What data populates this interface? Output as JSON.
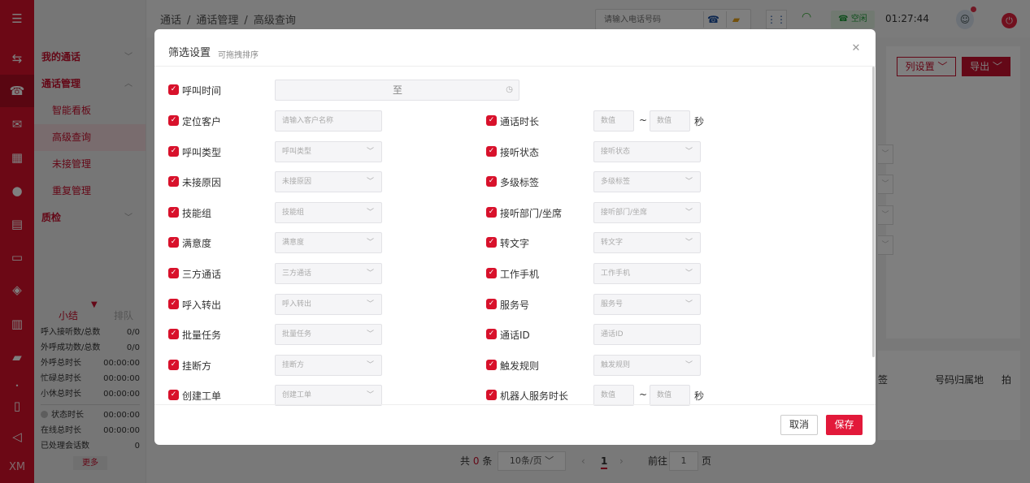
{
  "colors": {
    "brand": "#d8112b",
    "accent_dark": "#b30d22",
    "ok_green": "#1f9c3a",
    "save_button": "#e2193a"
  },
  "rail": {
    "icons": [
      "menu-icon",
      "transfer-icon",
      "telephone-icon",
      "chat-icon",
      "grid-icon",
      "person-icon",
      "clipboard-icon",
      "monitor-icon",
      "shield-icon",
      "bar-chart-icon",
      "message-icon",
      "dot-icon",
      "book-icon",
      "send-icon"
    ],
    "footer_text": "XM"
  },
  "sidebar": {
    "groups": [
      {
        "label": "我的通话"
      },
      {
        "label": "通话管理",
        "items": [
          "智能看板",
          "高级查询",
          "未接管理",
          "重复管理"
        ],
        "active": "高级查询"
      },
      {
        "label": "质检"
      }
    ],
    "stats": {
      "tab_active": "小结",
      "tab_inactive": "排队",
      "rows": [
        {
          "label": "呼入接听数/总数",
          "value": "0/0"
        },
        {
          "label": "外呼成功数/总数",
          "value": "0/0"
        },
        {
          "label": "外呼总时长",
          "value": "00:00:00"
        },
        {
          "label": "忙碌总时长",
          "value": "00:00:00"
        },
        {
          "label": "小休总时长",
          "value": "00:00:00"
        }
      ],
      "rows2": [
        {
          "label": "状态时长",
          "value": "00:00:00"
        },
        {
          "label": "在线总时长",
          "value": "00:00:00"
        },
        {
          "label": "已处理会话数",
          "value": "0"
        }
      ],
      "more": "更多"
    }
  },
  "topbar": {
    "breadcrumb": [
      "通话",
      "通话管理",
      "高级查询"
    ],
    "phone_placeholder": "请输入电话号码",
    "status": "空闲",
    "clock": "01:27:44"
  },
  "content": {
    "columns_button": "列设置",
    "export_button": "导出",
    "table_headers": [
      "签",
      "号码归属地",
      "拍"
    ],
    "pager": {
      "total_prefix": "共",
      "total": "0",
      "total_suffix": "条",
      "page_size": "10条/页",
      "current": "1",
      "goto_label": "前往",
      "goto_value": "1",
      "page_suffix": "页"
    }
  },
  "modal": {
    "title": "筛选设置",
    "subtitle": "可拖拽排序",
    "cancel": "取消",
    "save": "保存",
    "call_time": {
      "label": "呼叫时间",
      "to": "至"
    },
    "left_fields": [
      {
        "label": "定位客户",
        "placeholder": "请输入客户名称",
        "type": "input"
      },
      {
        "label": "呼叫类型",
        "placeholder": "呼叫类型",
        "type": "select"
      },
      {
        "label": "未接原因",
        "placeholder": "未接原因",
        "type": "select"
      },
      {
        "label": "技能组",
        "placeholder": "技能组",
        "type": "select"
      },
      {
        "label": "满意度",
        "placeholder": "满意度",
        "type": "select"
      },
      {
        "label": "三方通话",
        "placeholder": "三方通话",
        "type": "select"
      },
      {
        "label": "呼入转出",
        "placeholder": "呼入转出",
        "type": "select"
      },
      {
        "label": "批量任务",
        "placeholder": "批量任务",
        "type": "select"
      },
      {
        "label": "挂断方",
        "placeholder": "挂断方",
        "type": "select"
      },
      {
        "label": "创建工单",
        "placeholder": "创建工单",
        "type": "select"
      }
    ],
    "right_fields": [
      {
        "label": "通话时长",
        "type": "range",
        "min_placeholder": "数值",
        "max_placeholder": "数值",
        "sep": "~",
        "unit": "秒"
      },
      {
        "label": "接听状态",
        "placeholder": "接听状态",
        "type": "select"
      },
      {
        "label": "多级标签",
        "placeholder": "多级标签",
        "type": "select"
      },
      {
        "label": "接听部门/坐席",
        "placeholder": "接听部门/坐席",
        "type": "select"
      },
      {
        "label": "转文字",
        "placeholder": "转文字",
        "type": "select"
      },
      {
        "label": "工作手机",
        "placeholder": "工作手机",
        "type": "select"
      },
      {
        "label": "服务号",
        "placeholder": "服务号",
        "type": "select"
      },
      {
        "label": "通话ID",
        "placeholder": "通话ID",
        "type": "input"
      },
      {
        "label": "触发规则",
        "placeholder": "触发规则",
        "type": "select"
      },
      {
        "label": "机器人服务时长",
        "type": "range",
        "min_placeholder": "数值",
        "max_placeholder": "数值",
        "sep": "~",
        "unit": "秒"
      }
    ]
  }
}
